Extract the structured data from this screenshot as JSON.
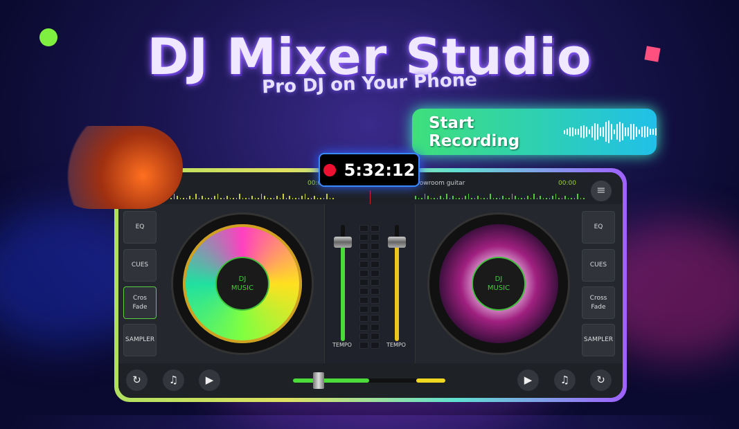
{
  "promo": {
    "title": "DJ Mixer Studio",
    "subtitle": "Pro DJ on Your Phone",
    "record_label": "Start Recording",
    "timer": "5:32:12"
  },
  "topbar": {
    "left_time": "00:0",
    "right_track": "howroom guitar",
    "right_time": "00:00"
  },
  "side_buttons": {
    "eq": "EQ",
    "cues": "CUES",
    "cross_fade_1": "Cros",
    "cross_fade_2": "Fade",
    "sampler": "SAMPLER",
    "right_cross_1": "Cross",
    "right_cross_2": "Fade"
  },
  "decks": {
    "left_label_1": "DJ",
    "left_label_2": "MUSIC",
    "right_label_1": "DJ",
    "right_label_2": "MUSIC"
  },
  "mixer": {
    "tempo_left": "TEMPO",
    "tempo_right": "TEMPO",
    "tempo_left_level": 0.85,
    "tempo_right_level": 0.85
  },
  "crossfader": {
    "position": 0.17
  },
  "colors": {
    "left_accent": "#4cdc3a",
    "right_accent": "#f0c418",
    "record_dot": "#ee1030"
  },
  "icons": [
    "refresh-icon",
    "playlist-icon",
    "play-icon",
    "filter-icon"
  ]
}
